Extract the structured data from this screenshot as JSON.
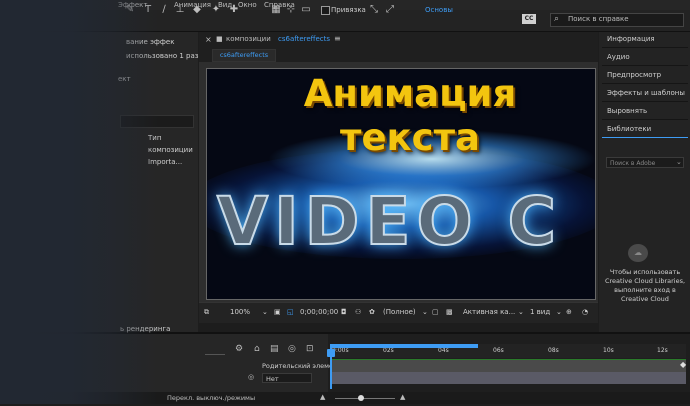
{
  "menubar": {
    "items": [
      "Эффект",
      "Анимация",
      "Вид",
      "Окно",
      "Справка"
    ]
  },
  "toolbar": {
    "snap_label": "Привязка",
    "workspace_label": "Основы",
    "search_placeholder": "Поиск в справке",
    "cc_icon": "CC"
  },
  "left_panel": {
    "effect_text": "вание эффек",
    "usage_text": "использовано 1 раз",
    "project_label": "ект",
    "type_col": "Тип",
    "type_comp": "композиции",
    "type_import": "Importa..."
  },
  "composition": {
    "header_label": "композиции",
    "comp_name": "cs6aftereffects",
    "tab_label": "cs6aftereffects",
    "video_text": "VIDEO C"
  },
  "comp_footer": {
    "zoom": "100%",
    "timecode": "0;00;00;00",
    "resolution": "(Полное)",
    "camera": "Активная ка...",
    "views": "1 вид"
  },
  "right_panel": {
    "items": [
      "Информация",
      "Аудио",
      "Предпросмотр",
      "Эффекты и шаблоны",
      "Выровнять",
      "Библиотеки"
    ],
    "lib_search_placeholder": "Поиск в Adobe",
    "cc_lib_text": "Чтобы использовать Creative Cloud Libraries, выполните вход в Creative Cloud"
  },
  "timeline": {
    "render_label": "ь рендеринга",
    "ticks": [
      "0:00s",
      "02s",
      "04s",
      "06s",
      "08s",
      "10s",
      "12s"
    ],
    "parent_label": "Родительский элемент",
    "parent_value": "Нет",
    "footer_text": "Перекл. выключ./режимы"
  },
  "headline": {
    "line1": "Анимация",
    "line2": "текста"
  },
  "colors": {
    "accent": "#3e9cf4",
    "headline": "#f3c50f"
  }
}
